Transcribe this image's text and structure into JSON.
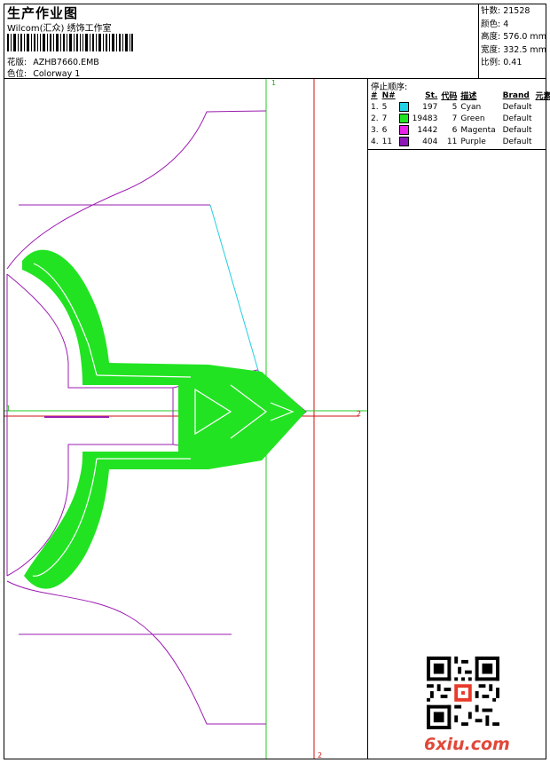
{
  "header": {
    "title": "生产作业图",
    "company": "Wilcom(汇众) 绣饰工作室",
    "design_label": "花版:",
    "design_file": "AZHB7660.EMB",
    "colorway_label": "色位:",
    "colorway": "Colorway 1"
  },
  "stats": {
    "stitches": "针数: 21528",
    "colors": "颜色: 4",
    "height": "高度: 576.0 mm",
    "width": "宽度: 332.5 mm",
    "scale": "比例: 0.41"
  },
  "stop_sequence": {
    "title": "停止顺序:",
    "headers": [
      "#",
      "N#",
      "",
      "St.",
      "代码",
      "描述",
      "Brand",
      "元素"
    ],
    "rows": [
      {
        "idx": "1.",
        "n": "5",
        "color": "#22D3E6",
        "st": "197",
        "code": "5",
        "desc": "Cyan",
        "brand": "Default"
      },
      {
        "idx": "2.",
        "n": "7",
        "color": "#22E322",
        "st": "19483",
        "code": "7",
        "desc": "Green",
        "brand": "Default"
      },
      {
        "idx": "3.",
        "n": "6",
        "color": "#E822E8",
        "st": "1442",
        "code": "6",
        "desc": "Magenta",
        "brand": "Default"
      },
      {
        "idx": "4.",
        "n": "11",
        "color": "#8E16B8",
        "st": "404",
        "code": "11",
        "desc": "Purple",
        "brand": "Default"
      }
    ]
  },
  "axes": {
    "green_v_top": "1",
    "green_h_left": "1",
    "red_h_right": "2",
    "red_v_bottom": "2"
  },
  "colors": {
    "outline": "#9B1BB0",
    "fill": "#22E322",
    "cyan": "#22CFE0",
    "green_axis": "#22CC22",
    "red_axis": "#CC1111"
  },
  "footer": {
    "watermark": "6xiu.com"
  }
}
